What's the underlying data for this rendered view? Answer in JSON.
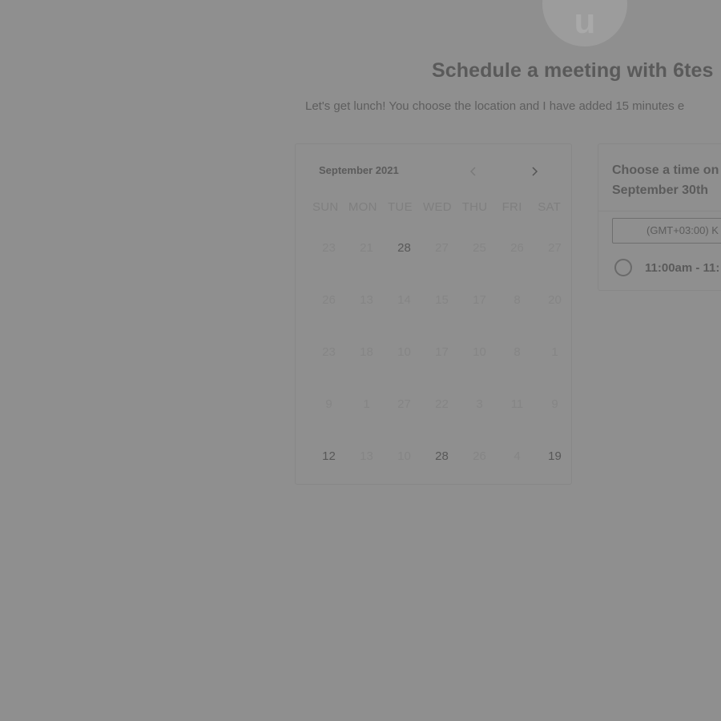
{
  "avatar": {
    "initial": "u"
  },
  "header": {
    "title": "Schedule a meeting with 6tes",
    "subtitle": "Let's get lunch! You choose the location and I have added 15 minutes e"
  },
  "calendar": {
    "month_label": "September 2021",
    "weekdays": [
      "SUN",
      "MON",
      "TUE",
      "WED",
      "THU",
      "FRI",
      "SAT"
    ],
    "weeks": [
      [
        "23",
        "21",
        "28",
        "27",
        "25",
        "26",
        "27"
      ],
      [
        "26",
        "13",
        "14",
        "15",
        "17",
        "8",
        "20"
      ],
      [
        "23",
        "18",
        "10",
        "17",
        "10",
        "8",
        "1"
      ],
      [
        "9",
        "1",
        "27",
        "22",
        "3",
        "11",
        "9"
      ],
      [
        "12",
        "13",
        "10",
        "28",
        "26",
        "4",
        "19"
      ]
    ],
    "active_days": [
      [
        0,
        2
      ],
      [
        4,
        0
      ],
      [
        4,
        3
      ],
      [
        4,
        6
      ]
    ]
  },
  "time_panel": {
    "heading_line1": "Choose a time on",
    "heading_line2": "September 30th",
    "timezone": "(GMT+03:00) K",
    "slots": [
      "11:00am - 11:"
    ]
  }
}
